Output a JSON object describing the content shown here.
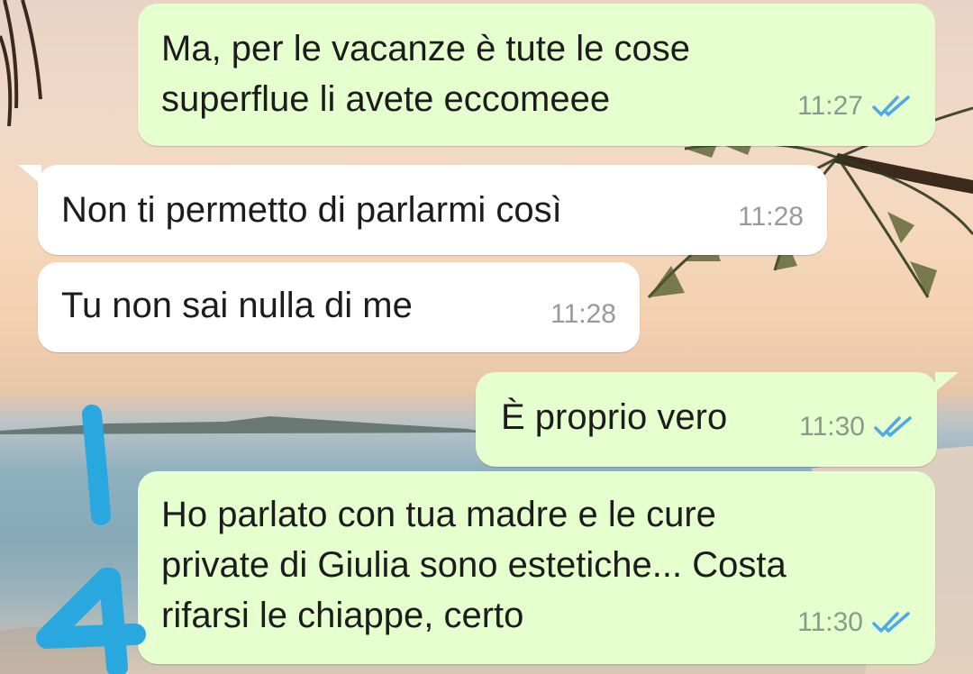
{
  "theme": {
    "outgoing_bubble_color": "#e6ffcf",
    "incoming_bubble_color": "#ffffff",
    "read_tick_color": "#4fa8e8",
    "annotation_color": "#29a8e0"
  },
  "messages": [
    {
      "direction": "outgoing",
      "text": "Ma, per le vacanze è tute le cose\nsuperflue li avete eccomeee",
      "time": "11:27",
      "status_icon": "double-check-read-icon"
    },
    {
      "direction": "incoming",
      "text": "Non ti permetto di parlarmi così",
      "time": "11:28"
    },
    {
      "direction": "incoming",
      "text": "Tu non sai nulla di me",
      "time": "11:28"
    },
    {
      "direction": "outgoing",
      "text": "È proprio vero",
      "time": "11:30",
      "status_icon": "double-check-read-icon"
    },
    {
      "direction": "outgoing",
      "text": "Ho parlato con tua madre e le cure\nprivate di Giulia sono estetiche... Costa\nrifarsi le chiappe, certo",
      "time": "11:30",
      "status_icon": "double-check-read-icon"
    }
  ],
  "annotation": {
    "description_icon": "handwritten-1-4-marker"
  }
}
